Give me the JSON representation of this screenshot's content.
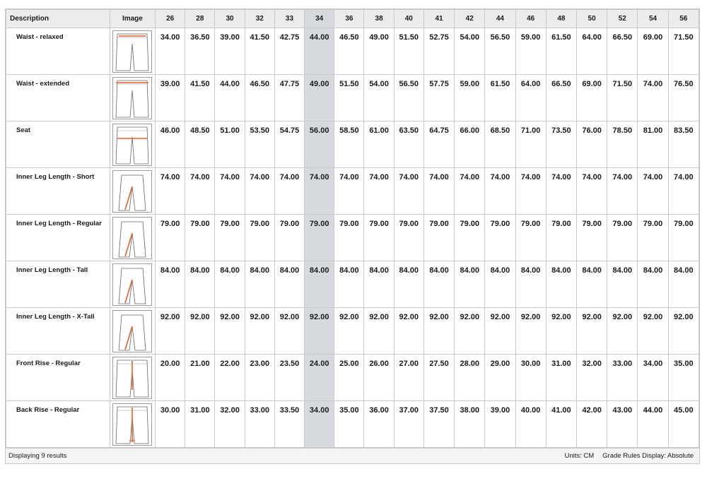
{
  "table": {
    "headers": {
      "description": "Description",
      "image": "Image",
      "sizes": [
        "26",
        "28",
        "30",
        "32",
        "33",
        "34",
        "36",
        "38",
        "40",
        "41",
        "42",
        "44",
        "46",
        "48",
        "50",
        "52",
        "54",
        "56"
      ]
    },
    "highlighted_size": "34",
    "rows": [
      {
        "description": "Waist - relaxed",
        "image_icon": "pants-waist-relaxed-diagram",
        "values": [
          "34.00",
          "36.50",
          "39.00",
          "41.50",
          "42.75",
          "44.00",
          "46.50",
          "49.00",
          "51.50",
          "52.75",
          "54.00",
          "56.50",
          "59.00",
          "61.50",
          "64.00",
          "66.50",
          "69.00",
          "71.50"
        ]
      },
      {
        "description": "Waist - extended",
        "image_icon": "pants-waist-extended-diagram",
        "values": [
          "39.00",
          "41.50",
          "44.00",
          "46.50",
          "47.75",
          "49.00",
          "51.50",
          "54.00",
          "56.50",
          "57.75",
          "59.00",
          "61.50",
          "64.00",
          "66.50",
          "69.00",
          "71.50",
          "74.00",
          "76.50"
        ]
      },
      {
        "description": "Seat",
        "image_icon": "pants-seat-diagram",
        "values": [
          "46.00",
          "48.50",
          "51.00",
          "53.50",
          "54.75",
          "56.00",
          "58.50",
          "61.00",
          "63.50",
          "64.75",
          "66.00",
          "68.50",
          "71.00",
          "73.50",
          "76.00",
          "78.50",
          "81.00",
          "83.50"
        ]
      },
      {
        "description": "Inner Leg Length - Short",
        "image_icon": "pants-inseam-diagram",
        "values": [
          "74.00",
          "74.00",
          "74.00",
          "74.00",
          "74.00",
          "74.00",
          "74.00",
          "74.00",
          "74.00",
          "74.00",
          "74.00",
          "74.00",
          "74.00",
          "74.00",
          "74.00",
          "74.00",
          "74.00",
          "74.00"
        ]
      },
      {
        "description": "Inner Leg Length - Regular",
        "image_icon": "pants-inseam-diagram",
        "values": [
          "79.00",
          "79.00",
          "79.00",
          "79.00",
          "79.00",
          "79.00",
          "79.00",
          "79.00",
          "79.00",
          "79.00",
          "79.00",
          "79.00",
          "79.00",
          "79.00",
          "79.00",
          "79.00",
          "79.00",
          "79.00"
        ]
      },
      {
        "description": "Inner Leg Length - Tall",
        "image_icon": "pants-inseam-diagram",
        "values": [
          "84.00",
          "84.00",
          "84.00",
          "84.00",
          "84.00",
          "84.00",
          "84.00",
          "84.00",
          "84.00",
          "84.00",
          "84.00",
          "84.00",
          "84.00",
          "84.00",
          "84.00",
          "84.00",
          "84.00",
          "84.00"
        ]
      },
      {
        "description": "Inner Leg Length - X-Tall",
        "image_icon": "pants-inseam-diagram",
        "values": [
          "92.00",
          "92.00",
          "92.00",
          "92.00",
          "92.00",
          "92.00",
          "92.00",
          "92.00",
          "92.00",
          "92.00",
          "92.00",
          "92.00",
          "92.00",
          "92.00",
          "92.00",
          "92.00",
          "92.00",
          "92.00"
        ]
      },
      {
        "description": "Front Rise - Regular",
        "image_icon": "pants-front-rise-diagram",
        "values": [
          "20.00",
          "21.00",
          "22.00",
          "23.00",
          "23.50",
          "24.00",
          "25.00",
          "26.00",
          "27.00",
          "27.50",
          "28.00",
          "29.00",
          "30.00",
          "31.00",
          "32.00",
          "33.00",
          "34.00",
          "35.00"
        ]
      },
      {
        "description": "Back Rise - Regular",
        "image_icon": "pants-back-rise-diagram",
        "values": [
          "30.00",
          "31.00",
          "32.00",
          "33.00",
          "33.50",
          "34.00",
          "35.00",
          "36.00",
          "37.00",
          "37.50",
          "38.00",
          "39.00",
          "40.00",
          "41.00",
          "42.00",
          "43.00",
          "44.00",
          "45.00"
        ]
      }
    ]
  },
  "footer": {
    "results_text": "Displaying 9 results",
    "units_text": "Units: CM",
    "grade_rules_text": "Grade Rules Display: Absolute"
  },
  "colors": {
    "highlight_column": "#d6d9de",
    "header_bg": "#ececec",
    "grid_line": "#c9c9c9",
    "measure_line": "#e8612c"
  }
}
